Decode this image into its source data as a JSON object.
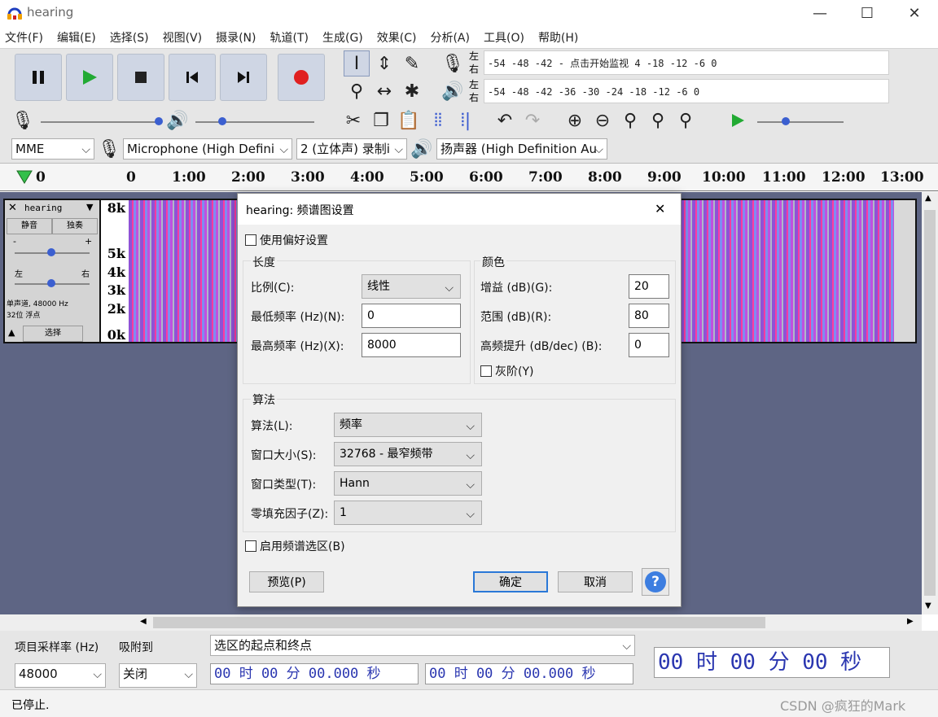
{
  "window": {
    "title": "hearing",
    "minimize": "—",
    "maximize": "☐",
    "close": "✕"
  },
  "menu": [
    "文件(F)",
    "编辑(E)",
    "选择(S)",
    "视图(V)",
    "摄录(N)",
    "轨道(T)",
    "生成(G)",
    "效果(C)",
    "分析(A)",
    "工具(O)",
    "帮助(H)"
  ],
  "meters": {
    "rec_lr_top": "左",
    "rec_lr_bot": "右",
    "rec_scale": "-54  -48  -42  -   点击开始监视  4   -18   -12   -6    0",
    "play_lr_top": "左",
    "play_lr_bot": "右",
    "play_scale": "-54  -48  -42  -36  -30  -24  -18  -12   -6    0"
  },
  "devices": {
    "host": "MME",
    "input": "Microphone (High Defini",
    "channels": "2 (立体声) 录制i",
    "output": "扬声器 (High Definition Au"
  },
  "ruler": [
    "0",
    "0",
    "1:00",
    "2:00",
    "3:00",
    "4:00",
    "5:00",
    "6:00",
    "7:00",
    "8:00",
    "9:00",
    "10:00",
    "11:00",
    "12:00",
    "13:00"
  ],
  "track": {
    "close": "✕",
    "name": "hearing",
    "mute": "静音",
    "solo": "独奏",
    "minus": "-",
    "plus": "+",
    "left": "左",
    "right": "右",
    "info1": "单声道, 48000 Hz",
    "info2": "32位 浮点",
    "select": "选择",
    "freqs": [
      "8k",
      "5k",
      "4k",
      "3k",
      "2k",
      "0k"
    ]
  },
  "bottom": {
    "rate_label": "项目采样率 (Hz)",
    "snap_label": "吸附到",
    "selection_label": "选区的起点和终点",
    "rate": "48000",
    "snap": "关闭",
    "sel_start": "00 时 00 分 00.000 秒",
    "sel_end": "00 时 00 分 00.000 秒",
    "big_time": "00 时 00 分 00 秒"
  },
  "status": {
    "text": "已停止.",
    "watermark": "CSDN @疯狂的Mark"
  },
  "dialog": {
    "title": "hearing: 频谱图设置",
    "close": "✕",
    "use_prefs": "使用偏好设置",
    "scale_group": "长度",
    "scale_label": "比例(C):",
    "scale_value": "线性",
    "min_freq_label": "最低频率 (Hz)(N):",
    "min_freq": "0",
    "max_freq_label": "最高频率 (Hz)(X):",
    "max_freq": "8000",
    "color_group": "颜色",
    "gain_label": "增益 (dB)(G):",
    "gain": "20",
    "range_label": "范围 (dB)(R):",
    "range": "80",
    "boost_label": "高频提升 (dB/dec) (B):",
    "boost": "0",
    "gray_label": "灰阶(Y)",
    "algo_group": "算法",
    "algo_label": "算法(L):",
    "algo_value": "频率",
    "window_size_label": "窗口大小(S):",
    "window_size": "32768 - 最窄频带",
    "window_type_label": "窗口类型(T):",
    "window_type": "Hann",
    "zero_pad_label": "零填充因子(Z):",
    "zero_pad": "1",
    "enable_sel": "启用频谱选区(B)",
    "preview": "预览(P)",
    "ok": "确定",
    "cancel": "取消",
    "help": "?"
  }
}
